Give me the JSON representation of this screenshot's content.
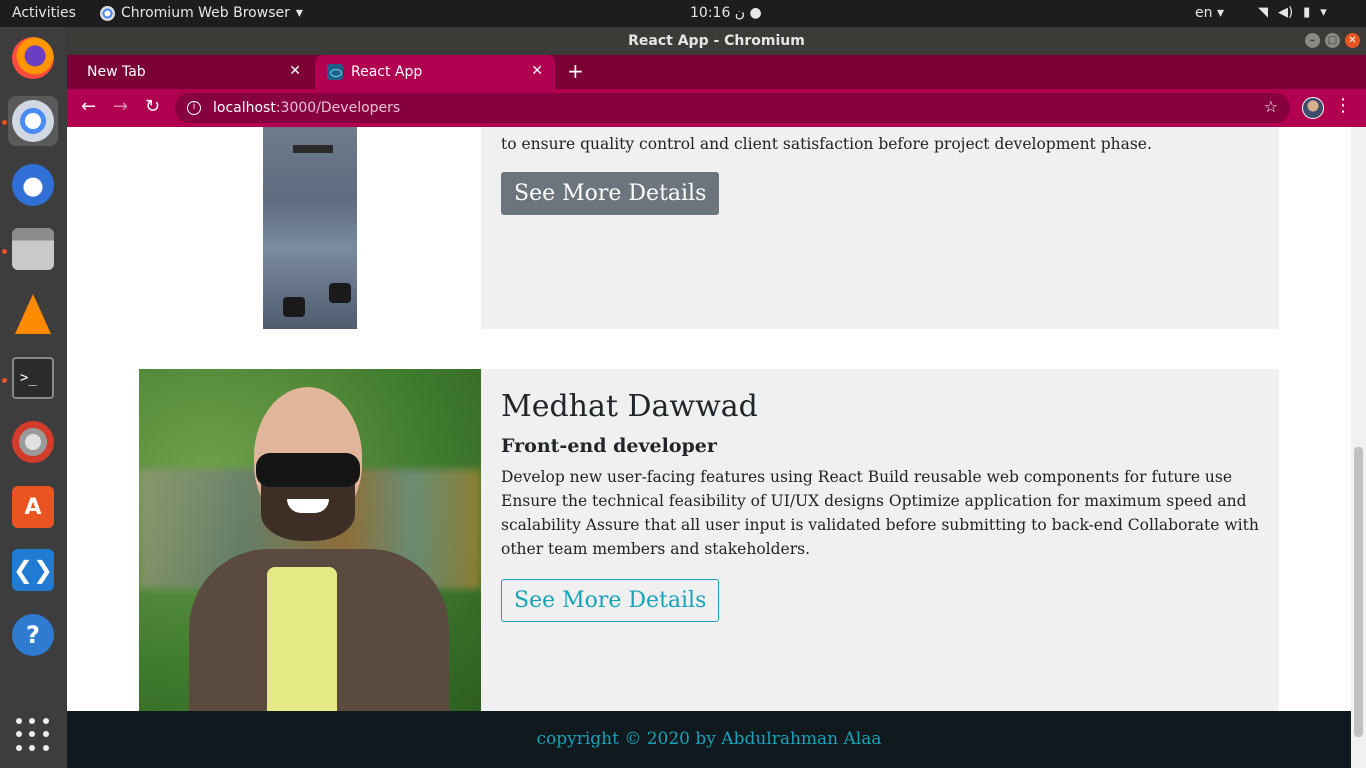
{
  "system": {
    "activities": "Activities",
    "app_menu": "Chromium Web Browser",
    "clock": "10:16 ن",
    "lang": "en"
  },
  "window": {
    "title": "React App - Chromium"
  },
  "tabs": [
    {
      "label": "New Tab"
    },
    {
      "label": "React App"
    }
  ],
  "address": {
    "host": "localhost",
    "path": ":3000/Developers"
  },
  "dock": {
    "items": [
      "firefox-icon",
      "chromium-icon",
      "thunderbird-icon",
      "files-icon",
      "vlc-icon",
      "terminal-icon",
      "settings-tools-icon",
      "software-store-icon",
      "vscode-icon",
      "help-icon",
      "show-apps-icon"
    ]
  },
  "developers": [
    {
      "desc": "to ensure quality control and client satisfaction before project development phase.",
      "button": "See More Details"
    },
    {
      "name": "Medhat Dawwad",
      "role": "Front-end developer",
      "desc": "Develop new user-facing features using React Build reusable web components for future use Ensure the technical feasibility of UI/UX designs Optimize application for maximum speed and scalability Assure that all user input is validated before submitting to back-end Collaborate with other team members and stakeholders.",
      "button": "See More Details"
    }
  ],
  "footer": {
    "text": "copyright © 2020 by Abdulrahman Alaa"
  },
  "colors": {
    "tab_strip": "#7a0035",
    "toolbar": "#b0004f",
    "card_bg": "#f0f0f0",
    "accent": "#17a2b8",
    "secondary_button": "#6c757d",
    "footer_bg": "#101a1e"
  }
}
